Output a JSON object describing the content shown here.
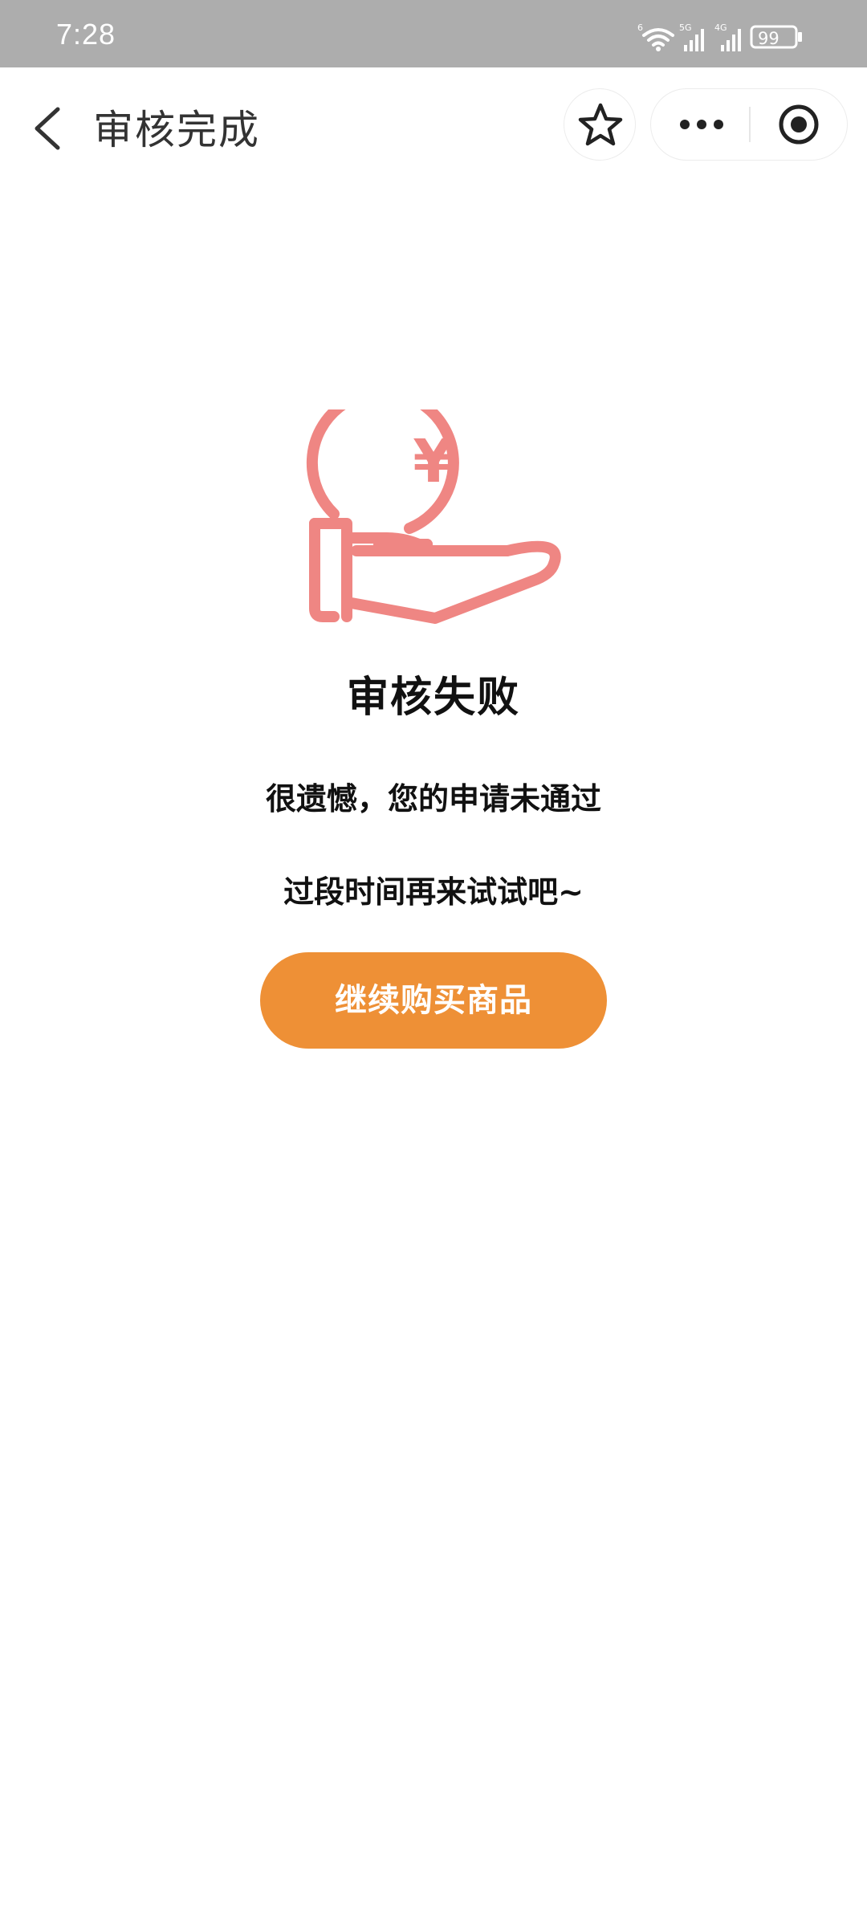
{
  "status_bar": {
    "time": "7:28",
    "battery": "99",
    "network_labels": [
      "6",
      "5G",
      "4G"
    ]
  },
  "nav": {
    "title": "审核完成"
  },
  "result": {
    "title": "审核失败",
    "message_line1": "很遗憾，您的申请未通过",
    "message_line2": "过段时间再来试试吧~",
    "button_label": "继续购买商品",
    "currency_symbol": "¥"
  },
  "colors": {
    "status_bar_bg": "#adadad",
    "icon_accent": "#ef8683",
    "button_bg": "#ee9036"
  },
  "icons": [
    "wifi-icon",
    "signal-icon",
    "battery-icon",
    "back-icon",
    "star-icon",
    "more-icon",
    "close-target-icon",
    "hand-coin-icon"
  ]
}
